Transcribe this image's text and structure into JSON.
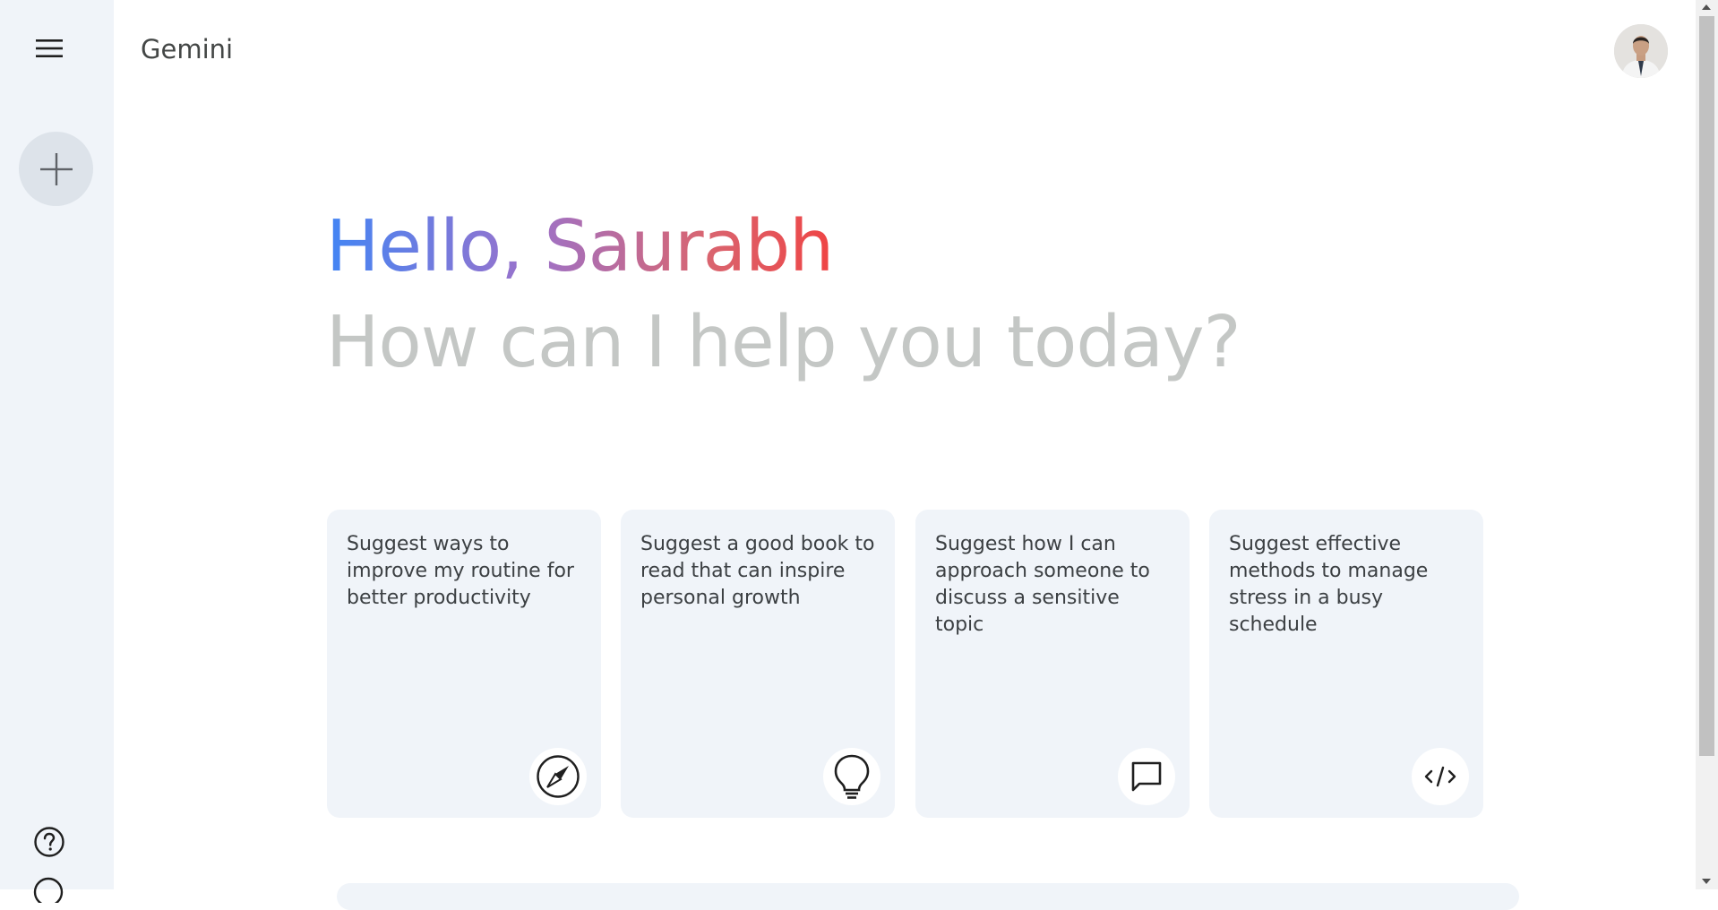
{
  "app": {
    "title": "Gemini"
  },
  "sidebar": {
    "menu_icon": "hamburger-menu-icon",
    "new_chat_icon": "plus-icon",
    "help_icon": "help-circle-icon",
    "activity_icon": "history-icon"
  },
  "greeting": {
    "hello": "Hello, Saurabh",
    "subtitle": "How can I help you today?",
    "gradient_colors": [
      "#4285f4",
      "#9b72cb",
      "#d96570",
      "#ef4444"
    ]
  },
  "suggestions": [
    {
      "text": "Suggest ways to improve my routine for better productivity",
      "icon": "compass-icon"
    },
    {
      "text": "Suggest a good book to read that can inspire personal growth",
      "icon": "lightbulb-icon"
    },
    {
      "text": "Suggest how I can approach someone to discuss a sensitive topic",
      "icon": "chat-bubble-icon"
    },
    {
      "text": "Suggest effective methods to manage stress in a busy schedule",
      "icon": "code-icon"
    }
  ],
  "colors": {
    "sidebar_bg": "#f0f4f9",
    "card_bg": "#f0f4f9",
    "subtitle": "#c4c7c5",
    "text": "#3c4043"
  }
}
